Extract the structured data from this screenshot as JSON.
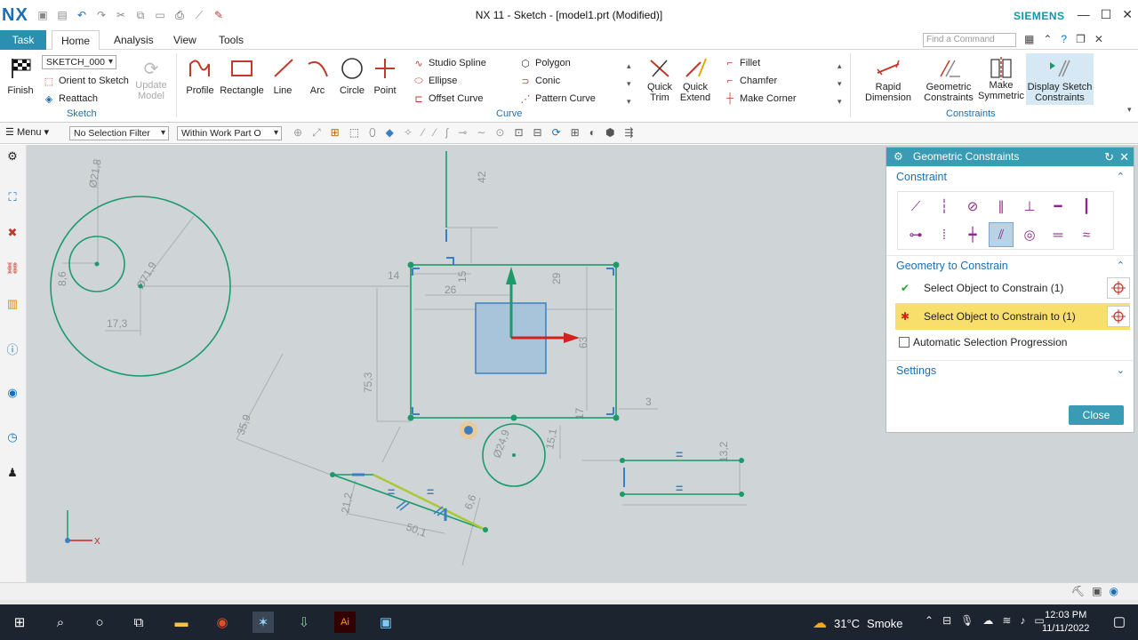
{
  "titlebar": {
    "logo": "NX",
    "title": "NX 11 - Sketch - [model1.prt (Modified)]",
    "brand": "SIEMENS",
    "minimize": "—",
    "maximize": "☐",
    "close": "✕"
  },
  "tabs": {
    "task": "Task",
    "home": "Home",
    "analysis": "Analysis",
    "view": "View",
    "tools": "Tools",
    "find_placeholder": "Find a Command"
  },
  "ribbon": {
    "sketch_group": {
      "finish": "Finish",
      "sketch_name": "SKETCH_000",
      "orient": "Orient to Sketch",
      "reattach": "Reattach",
      "update_model_line1": "Update",
      "update_model_line2": "Model",
      "label": "Sketch"
    },
    "curve_group": {
      "profile": "Profile",
      "rectangle": "Rectangle",
      "line": "Line",
      "arc": "Arc",
      "circle": "Circle",
      "point": "Point",
      "studio_spline": "Studio Spline",
      "polygon": "Polygon",
      "ellipse": "Ellipse",
      "conic": "Conic",
      "offset_curve": "Offset Curve",
      "pattern_curve": "Pattern Curve",
      "quick_trim_1": "Quick",
      "quick_trim_2": "Trim",
      "quick_extend_1": "Quick",
      "quick_extend_2": "Extend",
      "fillet": "Fillet",
      "chamfer": "Chamfer",
      "make_corner": "Make Corner",
      "label": "Curve"
    },
    "constraints_group": {
      "rapid_dim_1": "Rapid",
      "rapid_dim_2": "Dimension",
      "geo_cons_1": "Geometric",
      "geo_cons_2": "Constraints",
      "make_sym_1": "Make",
      "make_sym_2": "Symmetric",
      "display_1": "Display Sketch",
      "display_2": "Constraints",
      "label": "Constraints"
    }
  },
  "toolbar": {
    "menu": "Menu",
    "selection_filter": "No Selection Filter",
    "scope": "Within Work Part O"
  },
  "sketch": {
    "dims": {
      "d21_8": "Ø21,8",
      "d71_9": "Ø71,9",
      "d8_6": "8,6",
      "d17_3": "17,3",
      "d42": "42",
      "d14": "14",
      "d15": "15",
      "d26": "26",
      "d29": "29",
      "d75_3": "75,3",
      "d35_9": "35,9",
      "d3": "3",
      "d15_1": "15,1",
      "d24": "Ø24,9",
      "d21_2": "21,2",
      "d50_1": "50,1",
      "d6_6": "6,6",
      "d13_2": "13,2",
      "d17": "17",
      "d63": "63"
    },
    "equal_mark": "="
  },
  "dialog": {
    "title": "Geometric Constraints",
    "constraint_section": "Constraint",
    "geometry_section": "Geometry to Constrain",
    "select_object": "Select Object to Constrain (1)",
    "select_object_to": "Select Object to Constrain to (1)",
    "auto_progression": "Automatic Selection Progression",
    "settings_section": "Settings",
    "close": "Close"
  },
  "taskbar": {
    "temperature": "31°C",
    "weather": "Smoke",
    "time": "12:03 PM",
    "date": "11/11/2022"
  },
  "colors": {
    "accent": "#3a9bb5",
    "sketch_green": "#1d9a6c",
    "graphics_bg": "#cfd4d6",
    "highlight": "#f8df6b"
  }
}
